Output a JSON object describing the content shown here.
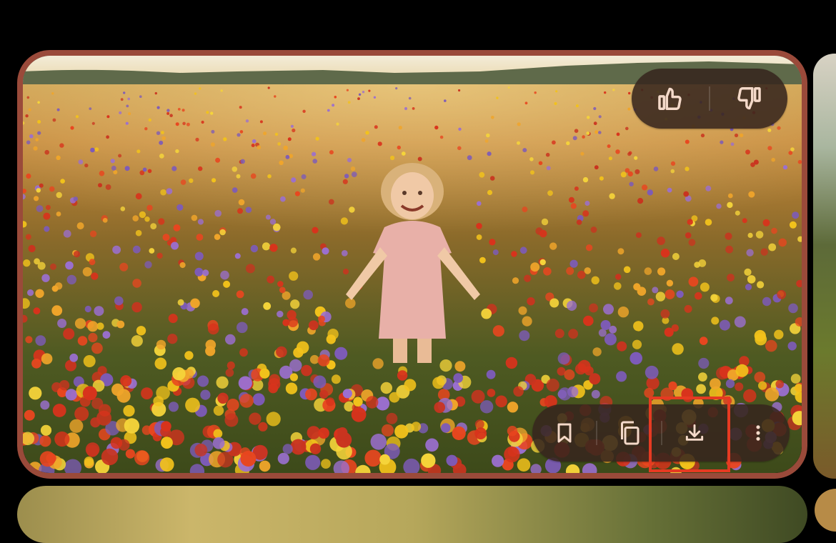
{
  "image_card": {
    "content": "photo",
    "border_color": "#9a4a3a"
  },
  "feedback_bar": {
    "like": {
      "icon": "thumbs-up-icon"
    },
    "dislike": {
      "icon": "thumbs-down-icon"
    }
  },
  "action_bar": {
    "bookmark": {
      "icon": "bookmark-icon"
    },
    "copy": {
      "icon": "copy-icon"
    },
    "download": {
      "icon": "download-icon",
      "highlighted": true
    },
    "more": {
      "icon": "more-vertical-icon"
    }
  },
  "colors": {
    "icon": "#f4d9c9",
    "pill_bg": "#37261e",
    "highlight": "#e63a22"
  }
}
